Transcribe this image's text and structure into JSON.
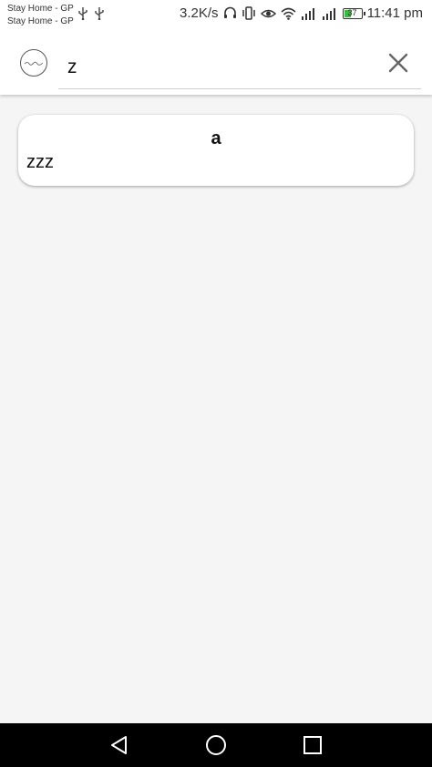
{
  "status_bar": {
    "notifications": [
      "Stay Home - GP",
      "Stay Home - GP"
    ],
    "net_speed": "3.2K/s",
    "battery_level": "37",
    "time": "11:41 pm"
  },
  "search": {
    "value": "z"
  },
  "results": [
    {
      "title": "a",
      "body": "zzz"
    }
  ],
  "colors": {
    "battery": "#35c03a",
    "nav_bar": "#000000",
    "background": "#f5f5f5"
  }
}
